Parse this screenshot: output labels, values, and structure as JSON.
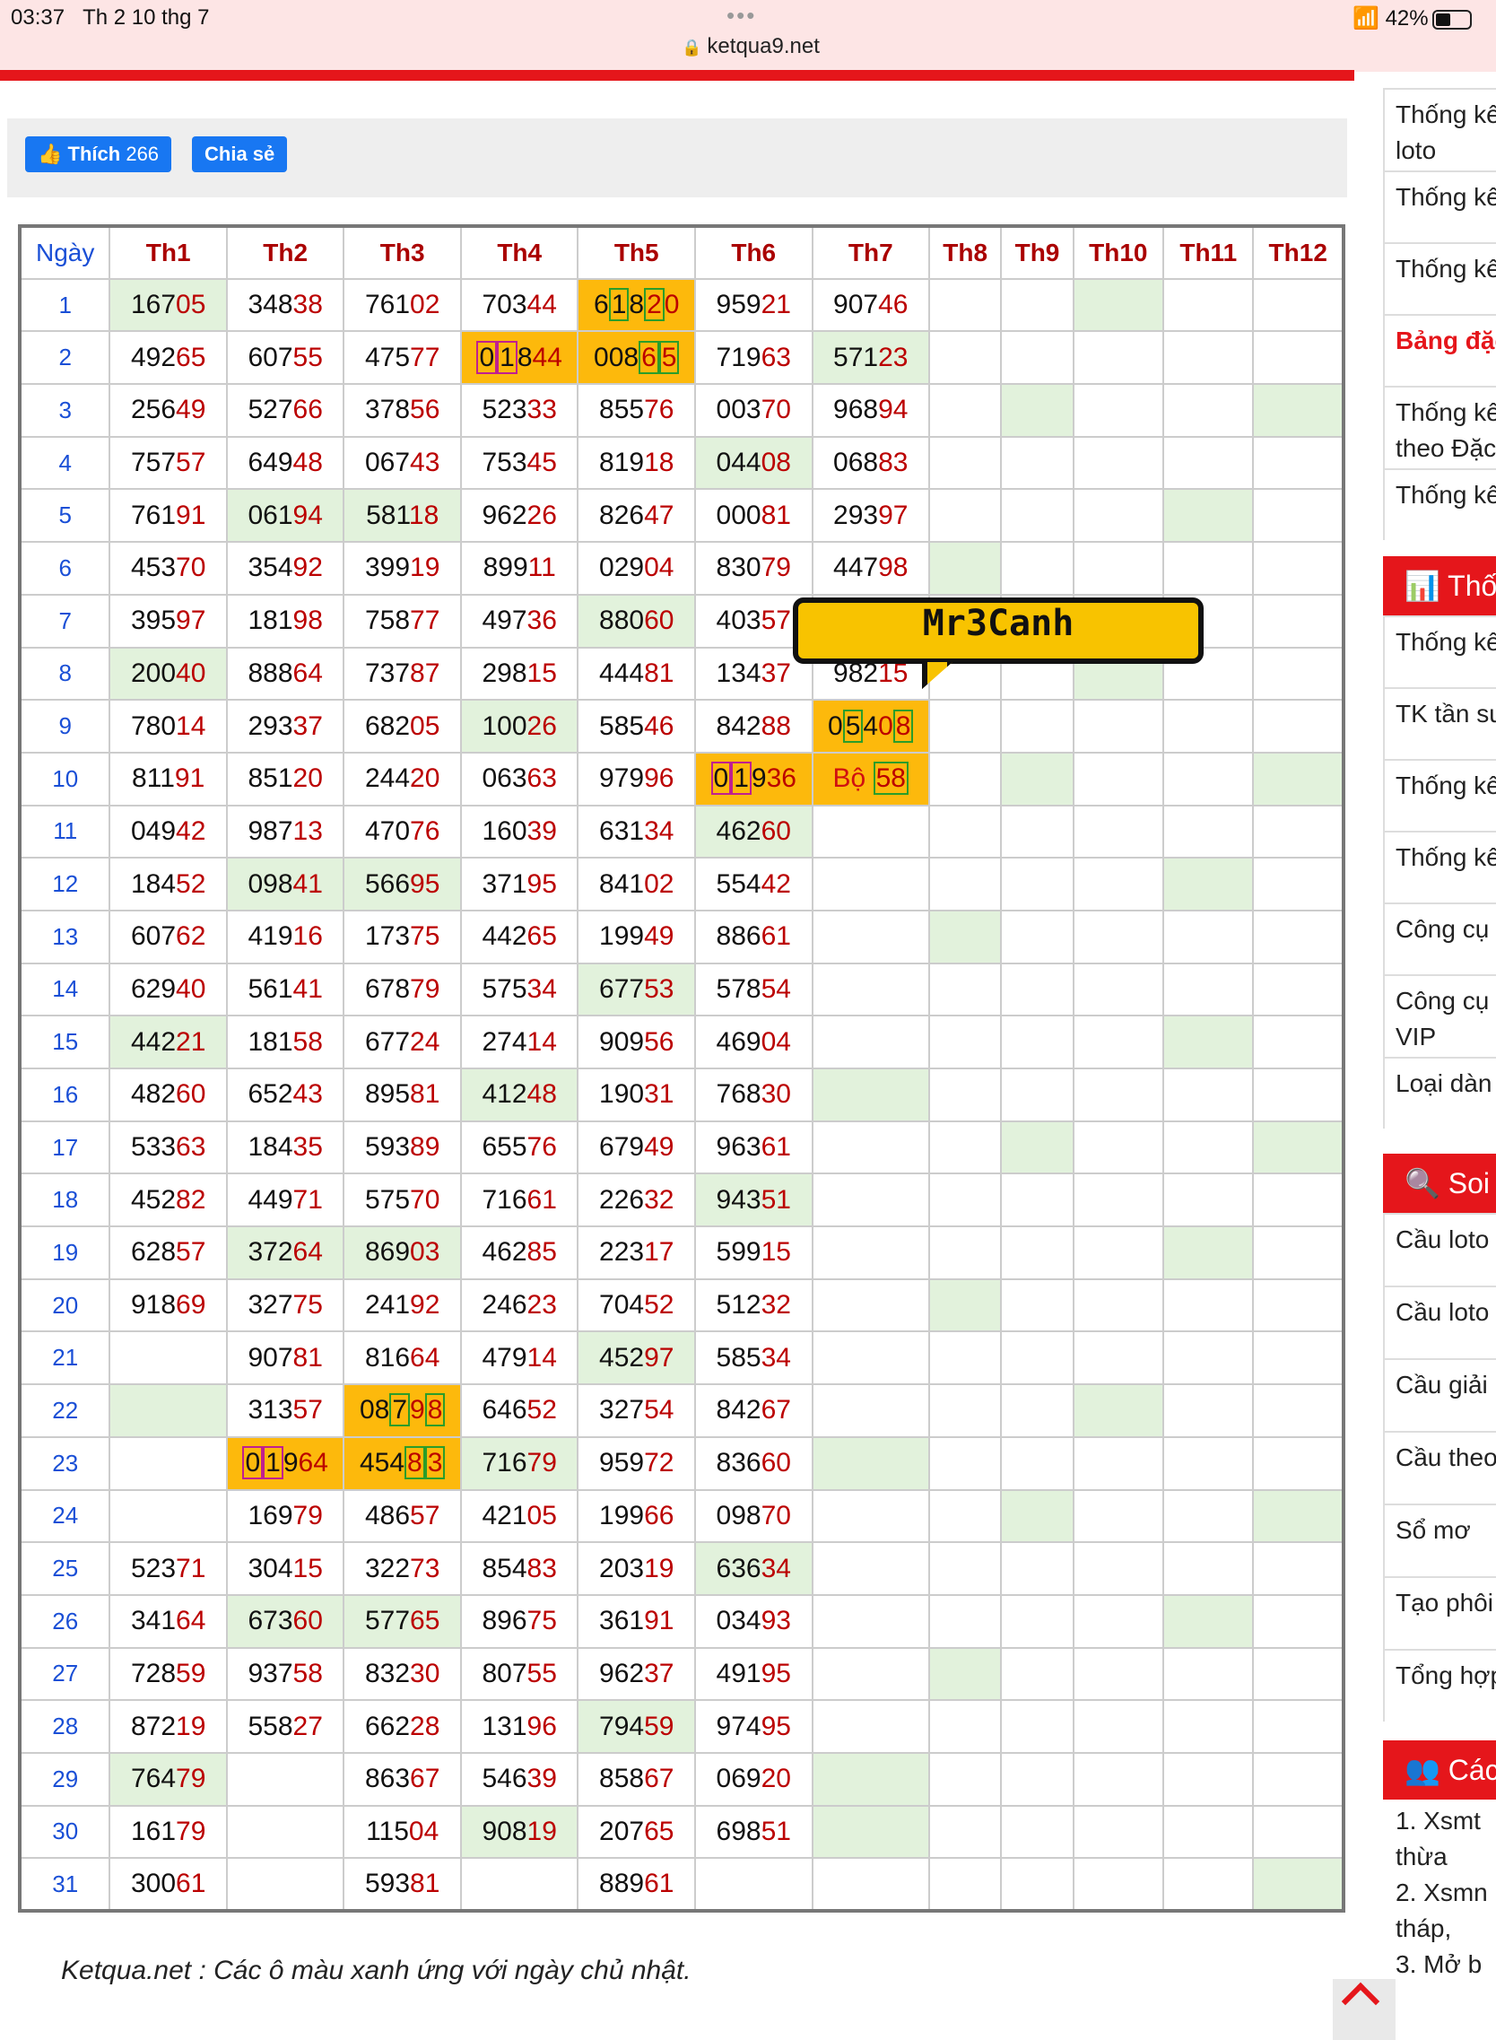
{
  "status": {
    "time": "03:37",
    "date": "Th 2 10 thg 7",
    "dots": "•••",
    "url": "ketqua9.net",
    "wifi": "wifi-icon",
    "battery": "42%"
  },
  "social": {
    "like_label": "Thích",
    "like_count": "266",
    "share_label": "Chia sẻ"
  },
  "table": {
    "headers": [
      "Ngày",
      "Th1",
      "Th2",
      "Th3",
      "Th4",
      "Th5",
      "Th6",
      "Th7",
      "Th8",
      "Th9",
      "Th10",
      "Th11",
      "Th12"
    ],
    "rows": [
      [
        "16705",
        "34838",
        "76102",
        "70344",
        "61820",
        "95921",
        "90746"
      ],
      [
        "49265",
        "60755",
        "47577",
        "01844",
        "00865",
        "71963",
        "57123"
      ],
      [
        "25649",
        "52766",
        "37856",
        "52333",
        "85576",
        "00370",
        "96894"
      ],
      [
        "75757",
        "64948",
        "06743",
        "75345",
        "81918",
        "04408",
        "06883"
      ],
      [
        "76191",
        "06194",
        "58118",
        "96226",
        "82647",
        "00081",
        "29397"
      ],
      [
        "45370",
        "35492",
        "39919",
        "89911",
        "02904",
        "83079",
        "44798"
      ],
      [
        "39597",
        "18198",
        "75877",
        "49736",
        "88060",
        "40357",
        ""
      ],
      [
        "20040",
        "88864",
        "73787",
        "29815",
        "44481",
        "13437",
        "98215"
      ],
      [
        "78014",
        "29337",
        "68205",
        "10026",
        "58546",
        "84288",
        "05408"
      ],
      [
        "81191",
        "85120",
        "24420",
        "06363",
        "97996",
        "01936",
        "58"
      ],
      [
        "04942",
        "98713",
        "47076",
        "16039",
        "63134",
        "46260",
        ""
      ],
      [
        "18452",
        "09841",
        "56695",
        "37195",
        "84102",
        "55442",
        ""
      ],
      [
        "60762",
        "41916",
        "17375",
        "44265",
        "19949",
        "88661",
        ""
      ],
      [
        "62940",
        "56141",
        "67879",
        "57534",
        "67753",
        "57854",
        ""
      ],
      [
        "44221",
        "18158",
        "67724",
        "27414",
        "90956",
        "46904",
        ""
      ],
      [
        "48260",
        "65243",
        "89581",
        "41248",
        "19031",
        "76830",
        ""
      ],
      [
        "53363",
        "18435",
        "59389",
        "65576",
        "67949",
        "96361",
        ""
      ],
      [
        "45282",
        "44971",
        "57570",
        "71661",
        "22632",
        "94351",
        ""
      ],
      [
        "62857",
        "37264",
        "86903",
        "46285",
        "22317",
        "59915",
        ""
      ],
      [
        "91869",
        "32775",
        "24192",
        "24623",
        "70452",
        "51232",
        ""
      ],
      [
        "",
        "90781",
        "81664",
        "47914",
        "45297",
        "58534",
        ""
      ],
      [
        "",
        "31357",
        "08798",
        "64652",
        "32754",
        "84267",
        ""
      ],
      [
        "",
        "01964",
        "45483",
        "71679",
        "95972",
        "83660",
        ""
      ],
      [
        "",
        "16979",
        "48657",
        "42105",
        "19966",
        "09870",
        ""
      ],
      [
        "52371",
        "30415",
        "32273",
        "85483",
        "20319",
        "63634",
        ""
      ],
      [
        "34164",
        "67360",
        "57765",
        "89675",
        "36191",
        "03493",
        ""
      ],
      [
        "72859",
        "93758",
        "83230",
        "80755",
        "96237",
        "49195",
        ""
      ],
      [
        "87219",
        "55827",
        "66228",
        "13196",
        "79459",
        "97495",
        ""
      ],
      [
        "76479",
        "",
        "86367",
        "54639",
        "85867",
        "06920",
        ""
      ],
      [
        "16179",
        "",
        "11504",
        "90819",
        "20765",
        "69851",
        ""
      ],
      [
        "30061",
        "",
        "59381",
        "",
        "88961",
        "",
        ""
      ]
    ],
    "bo_label": "Bộ"
  },
  "bubble_text": "Mr3Canh",
  "note": "Ketqua.net : Các ô màu xanh ứng với ngày chủ nhật.",
  "sidebar": {
    "items1": [
      "Thống kê",
      "loto",
      "Thống kê",
      "Thống kê",
      "Bảng đặc",
      "Thống kê",
      "theo Đặc",
      "Thống kê"
    ],
    "head1": "Thố",
    "items2": [
      "Thống kê",
      "TK tần su",
      "Thống kê",
      "Thống kê",
      "Công cụ",
      "Công cụ",
      "VIP",
      "Loại dàn"
    ],
    "head2": "Soi",
    "items3": [
      "Cầu loto",
      "Cầu loto",
      "Cầu giải",
      "Cầu theo",
      "Sổ mơ",
      "Tạo phôi",
      "Tổng hợp"
    ],
    "head3": "Các",
    "list": [
      "Xsmt",
      "thừa",
      "Xsmn",
      "tháp,",
      "Mở b"
    ]
  },
  "colors": {
    "red": "#e5161b",
    "green_cell": "#e2f2dc",
    "orange_cell": "#fdb90c",
    "day_blue": "#1a4fd6",
    "num_red": "#b00000"
  }
}
